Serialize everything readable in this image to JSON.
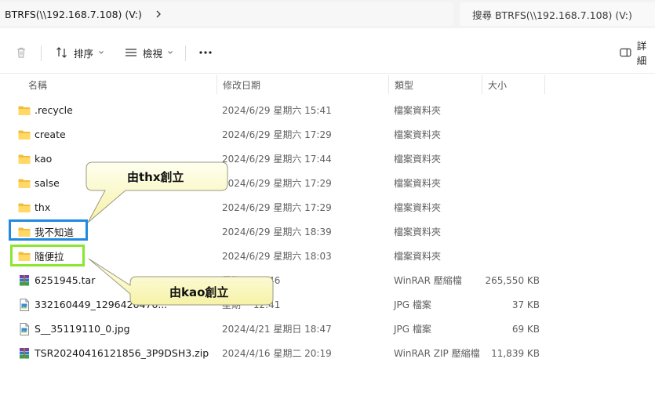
{
  "address": {
    "path": "BTRFS(\\\\192.168.7.108) (V:)",
    "search_placeholder": "搜尋 BTRFS(\\\\192.168.7.108) (V:)"
  },
  "toolbar": {
    "sort_label": "排序",
    "view_label": "檢視",
    "more_label": "...",
    "details_label": "詳細"
  },
  "columns": {
    "name": "名稱",
    "modified": "修改日期",
    "type": "類型",
    "size": "大小"
  },
  "files": [
    {
      "name": ".recycle",
      "date": "2024/6/29 星期六 15:41",
      "type": "檔案資料夾",
      "size": "",
      "icon": "folder-icon"
    },
    {
      "name": "create",
      "date": "2024/6/29 星期六 17:29",
      "type": "檔案資料夾",
      "size": "",
      "icon": "folder-icon"
    },
    {
      "name": "kao",
      "date": "2024/6/29 星期六 17:44",
      "type": "檔案資料夾",
      "size": "",
      "icon": "folder-icon"
    },
    {
      "name": "salse",
      "date": "2024/6/29 星期六 17:29",
      "type": "檔案資料夾",
      "size": "",
      "icon": "folder-icon"
    },
    {
      "name": "thx",
      "date": "2024/6/29 星期六 17:29",
      "type": "檔案資料夾",
      "size": "",
      "icon": "folder-icon"
    },
    {
      "name": "我不知道",
      "date": "2024/6/29 星期六 18:39",
      "type": "檔案資料夾",
      "size": "",
      "icon": "folder-icon"
    },
    {
      "name": "隨便拉",
      "date": "2024/6/29 星期六 18:03",
      "type": "檔案資料夾",
      "size": "",
      "icon": "folder-icon"
    },
    {
      "name": "6251945.tar",
      "date": "星期二 19:46",
      "type": "WinRAR 壓縮檔",
      "size": "265,550 KB",
      "icon": "winrar-archive-icon"
    },
    {
      "name": "332160449_1296426476...",
      "date": "星期一 12:41",
      "type": "JPG 檔案",
      "size": "37 KB",
      "icon": "jpg-file-icon"
    },
    {
      "name": "S__35119110_0.jpg",
      "date": "2024/4/21 星期日 18:47",
      "type": "JPG 檔案",
      "size": "69 KB",
      "icon": "jpg-file-icon"
    },
    {
      "name": "TSR20240416121856_3P9DSH3.zip",
      "date": "2024/4/16 星期二 20:19",
      "type": "WinRAR ZIP 壓縮檔",
      "size": "11,839 KB",
      "icon": "winrar-archive-icon"
    }
  ],
  "annotations": {
    "callout_thx": "由thx創立",
    "callout_kao": "由kao創立",
    "highlight_blue_color": "#1f8ae0",
    "highlight_green_color": "#8ae62e",
    "callout_fill": "#fefdc9"
  }
}
